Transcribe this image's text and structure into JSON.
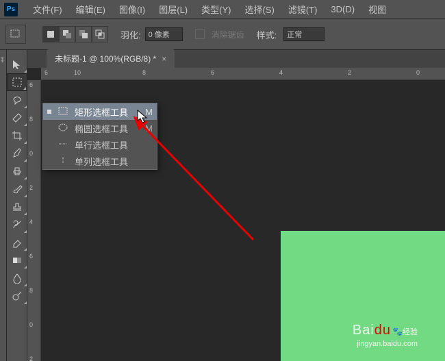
{
  "menu": {
    "items": [
      "文件(F)",
      "编辑(E)",
      "图像(I)",
      "图层(L)",
      "类型(Y)",
      "选择(S)",
      "滤镜(T)",
      "3D(D)",
      "视图"
    ]
  },
  "options": {
    "feather_label": "羽化:",
    "feather_value": "0 像素",
    "antialias": "消除锯齿",
    "style_label": "样式:",
    "style_value": "正常"
  },
  "tab": {
    "title": "未标题-1 @ 100%(RGB/8) *",
    "close": "×"
  },
  "flyout": {
    "items": [
      {
        "label": "矩形选框工具",
        "shortcut": "M",
        "selected": true
      },
      {
        "label": "椭圆选框工具",
        "shortcut": "M",
        "selected": false
      },
      {
        "label": "单行选框工具",
        "shortcut": "",
        "selected": false
      },
      {
        "label": "单列选框工具",
        "shortcut": "",
        "selected": false
      }
    ]
  },
  "ruler_h": {
    "labels": [
      "6",
      "10",
      "8",
      "6",
      "4",
      "2",
      "0"
    ]
  },
  "ruler_v": {
    "labels": [
      "6",
      "8",
      "0",
      "2",
      "4",
      "6",
      "8",
      "0",
      "2"
    ]
  },
  "watermark": {
    "brand": "Bai",
    "brand2": "du",
    "tag": "经验",
    "url": "jingyan.baidu.com"
  }
}
